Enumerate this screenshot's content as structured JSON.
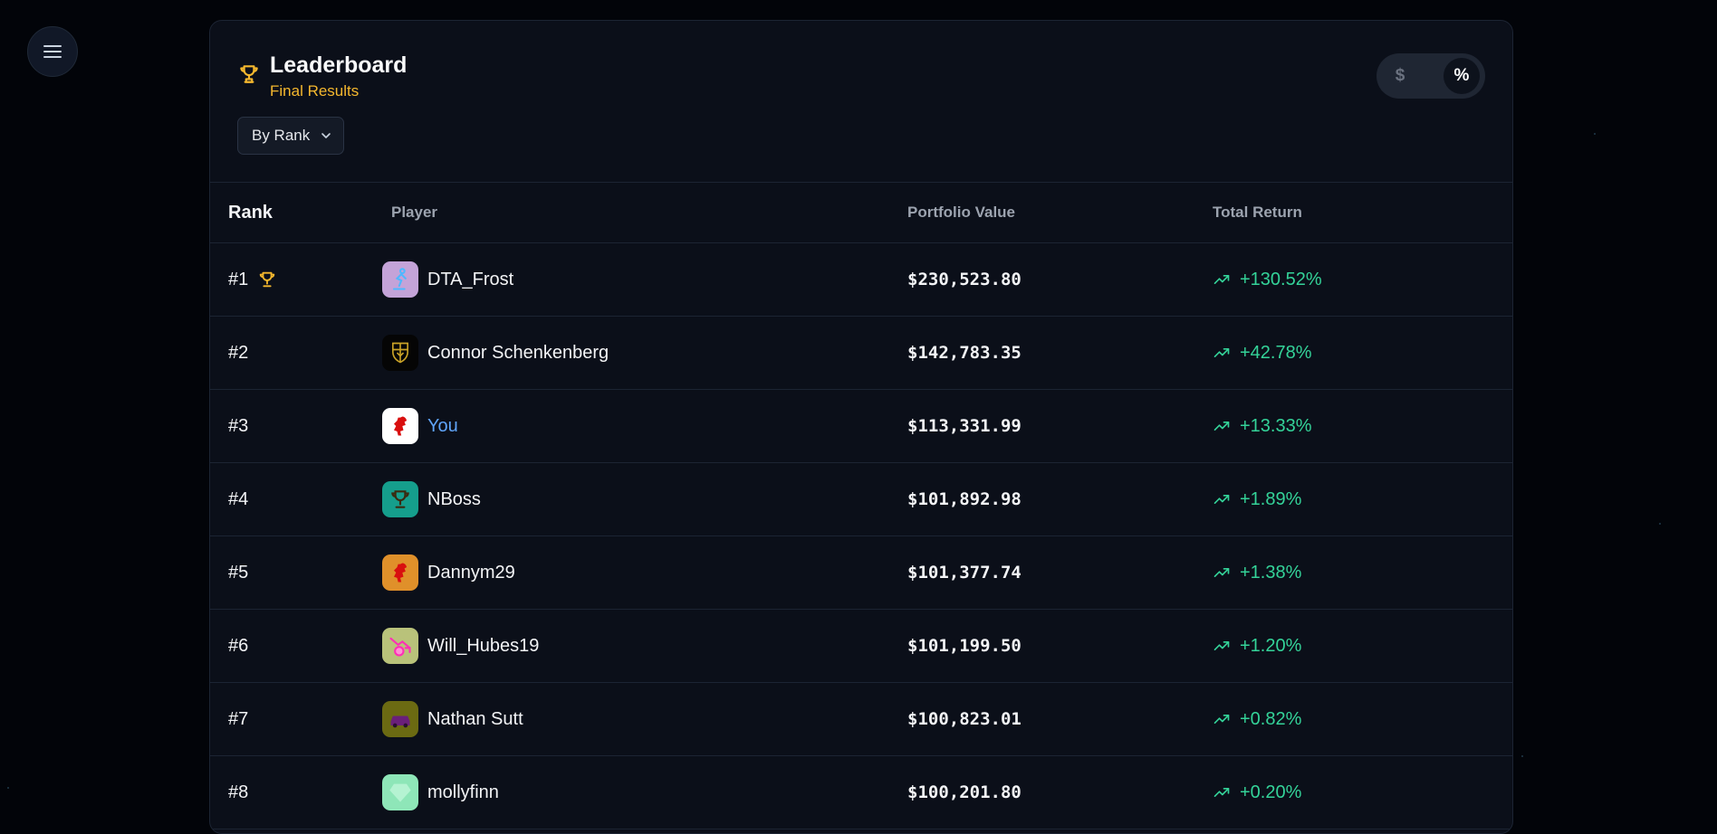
{
  "header": {
    "title": "Leaderboard",
    "subtitle": "Final Results",
    "sort_label": "By Rank",
    "toggle": {
      "dollar": "$",
      "percent": "%",
      "active": "percent"
    }
  },
  "columns": {
    "rank": "Rank",
    "player": "Player",
    "value": "Portfolio Value",
    "return": "Total Return"
  },
  "colors": {
    "accent": "#f5b82e",
    "positive": "#34d399",
    "you": "#60a5fa"
  },
  "rows": [
    {
      "rank": "#1",
      "name": "DTA_Frost",
      "value": "$230,523.80",
      "return": "+130.52%",
      "avatar_icon": "skater-icon",
      "avatar_bg": "#c4a3d8",
      "trophy": true
    },
    {
      "rank": "#2",
      "name": "Connor Schenkenberg",
      "value": "$142,783.35",
      "return": "+42.78%",
      "avatar_icon": "crest-icon",
      "avatar_bg": "#050505"
    },
    {
      "rank": "#3",
      "name": "You",
      "value": "$113,331.99",
      "return": "+13.33%",
      "avatar_icon": "horse-icon",
      "avatar_bg": "#ffffff",
      "is_you": true
    },
    {
      "rank": "#4",
      "name": "NBoss",
      "value": "$101,892.98",
      "return": "+1.89%",
      "avatar_icon": "trophy-icon",
      "avatar_bg": "#159e8c"
    },
    {
      "rank": "#5",
      "name": "Dannym29",
      "value": "$101,377.74",
      "return": "+1.38%",
      "avatar_icon": "horse-icon",
      "avatar_bg": "#e0902a"
    },
    {
      "rank": "#6",
      "name": "Will_Hubes19",
      "value": "$101,199.50",
      "return": "+1.20%",
      "avatar_icon": "pig-icon",
      "avatar_bg": "#b9c27a"
    },
    {
      "rank": "#7",
      "name": "Nathan Sutt",
      "value": "$100,823.01",
      "return": "+0.82%",
      "avatar_icon": "car-icon",
      "avatar_bg": "#6b6a12"
    },
    {
      "rank": "#8",
      "name": "mollyfinn",
      "value": "$100,201.80",
      "return": "+0.20%",
      "avatar_icon": "gem-icon",
      "avatar_bg": "#8ee6b8"
    }
  ]
}
